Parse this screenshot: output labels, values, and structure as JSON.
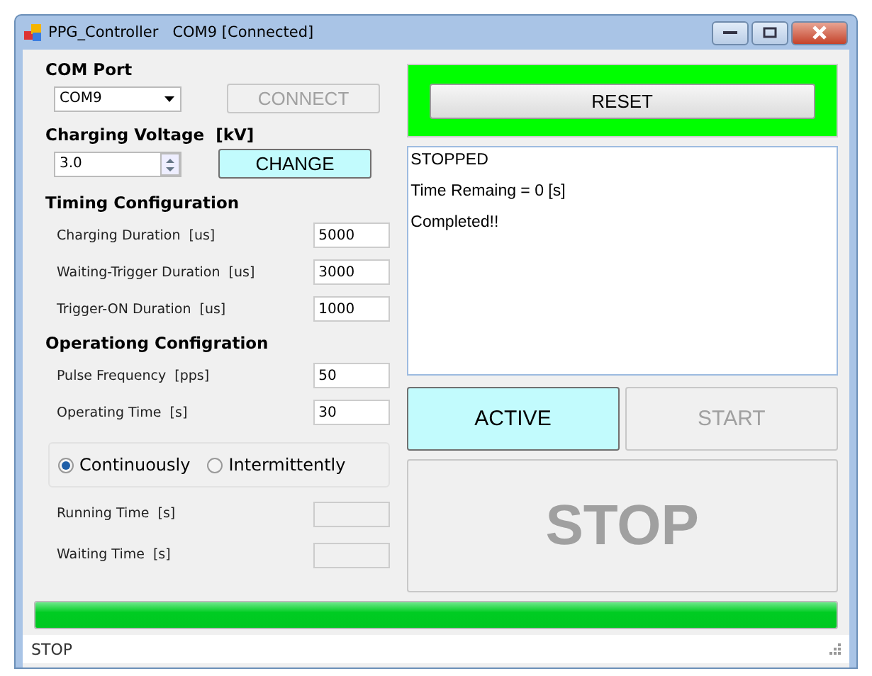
{
  "window": {
    "title": "PPG_Controller   COM9 [Connected]"
  },
  "com_port": {
    "label": "COM Port",
    "value": "COM9",
    "connect": {
      "label": "CONNECT",
      "disabled": true
    }
  },
  "voltage": {
    "label": "Charging Voltage  [kV]",
    "value": "3.0",
    "change": {
      "label": "CHANGE",
      "highlighted": true
    }
  },
  "timing": {
    "label": "Timing Configuration",
    "fields": [
      {
        "label": "Charging Duration  [us]",
        "value": "5000"
      },
      {
        "label": "Waiting-Trigger Duration  [us]",
        "value": "3000"
      },
      {
        "label": "Trigger-ON Duration  [us]",
        "value": "1000"
      }
    ]
  },
  "operating": {
    "label": "Operationg Configration",
    "fields": [
      {
        "label": "Pulse Frequency  [pps]",
        "value": "50"
      },
      {
        "label": "Operating Time  [s]",
        "value": "30"
      }
    ]
  },
  "mode": [
    {
      "label": "Continuously",
      "selected": true
    },
    {
      "label": "Intermittently",
      "selected": false
    }
  ],
  "interval_fields": [
    {
      "label": "Running Time  [s]",
      "disabled": true
    },
    {
      "label": "Waiting Time  [s]",
      "disabled": true
    }
  ],
  "reset": {
    "label": "RESET"
  },
  "log": [
    "STOPPED",
    "Time Remaing = 0 [s]",
    "Completed!!"
  ],
  "buttons": [
    {
      "label": "ACTIVE",
      "highlighted": true,
      "disabled": false
    },
    {
      "label": "START",
      "highlighted": false,
      "disabled": true
    }
  ],
  "stop": {
    "label": "STOP",
    "disabled": true
  },
  "progress": {
    "level": 1
  },
  "status_bar": {
    "text": "STOP"
  }
}
